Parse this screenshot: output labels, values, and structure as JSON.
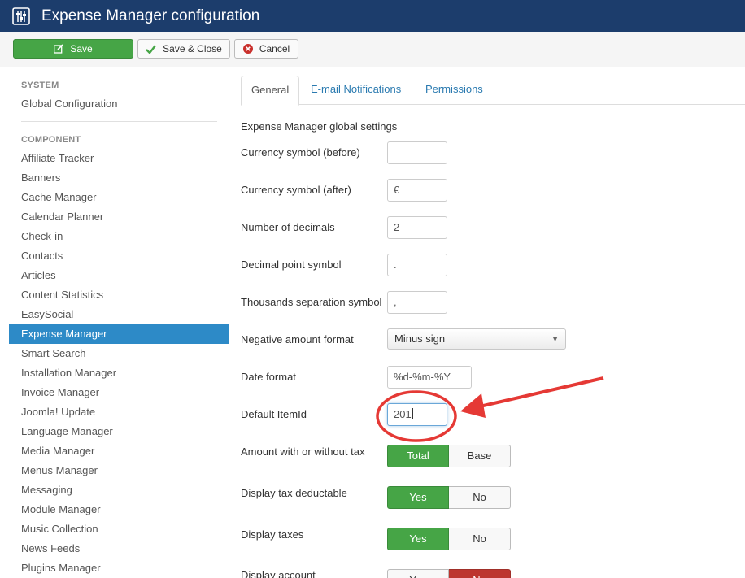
{
  "window": {
    "title": "Expense Manager configuration",
    "app_icon": "sliders-icon"
  },
  "toolbar": {
    "save": {
      "label": "Save",
      "icon": "edit-icon"
    },
    "save_close": {
      "label": "Save & Close",
      "icon": "check-icon"
    },
    "cancel": {
      "label": "Cancel",
      "icon": "cancel-circle-icon"
    }
  },
  "sidebar": {
    "system_heading": "SYSTEM",
    "global_config": "Global Configuration",
    "component_heading": "COMPONENT",
    "items": [
      {
        "label": "Affiliate Tracker"
      },
      {
        "label": "Banners"
      },
      {
        "label": "Cache Manager"
      },
      {
        "label": "Calendar Planner"
      },
      {
        "label": "Check-in"
      },
      {
        "label": "Contacts"
      },
      {
        "label": "Articles"
      },
      {
        "label": "Content Statistics"
      },
      {
        "label": "EasySocial"
      },
      {
        "label": "Expense Manager",
        "active": true
      },
      {
        "label": "Smart Search"
      },
      {
        "label": "Installation Manager"
      },
      {
        "label": "Invoice Manager"
      },
      {
        "label": "Joomla! Update"
      },
      {
        "label": "Language Manager"
      },
      {
        "label": "Media Manager"
      },
      {
        "label": "Menus Manager"
      },
      {
        "label": "Messaging"
      },
      {
        "label": "Module Manager"
      },
      {
        "label": "Music Collection"
      },
      {
        "label": "News Feeds"
      },
      {
        "label": "Plugins Manager"
      }
    ]
  },
  "tabs": [
    {
      "label": "General",
      "active": true
    },
    {
      "label": "E-mail Notifications"
    },
    {
      "label": "Permissions"
    }
  ],
  "form": {
    "section_title": "Expense Manager global settings",
    "currency_before": {
      "label": "Currency symbol (before)",
      "value": ""
    },
    "currency_after": {
      "label": "Currency symbol (after)",
      "value": "€"
    },
    "decimals": {
      "label": "Number of decimals",
      "value": "2"
    },
    "decimal_point": {
      "label": "Decimal point symbol",
      "value": "."
    },
    "thousands_sep": {
      "label": "Thousands separation symbol",
      "value": ","
    },
    "negative_format": {
      "label": "Negative amount format",
      "value": "Minus sign"
    },
    "date_format": {
      "label": "Date format",
      "value": "%d-%m-%Y"
    },
    "default_itemid": {
      "label": "Default ItemId",
      "value": "201"
    },
    "amount_tax": {
      "label": "Amount with or without tax",
      "option_a": "Total",
      "option_b": "Base",
      "selected": "Total"
    },
    "tax_deductable": {
      "label": "Display tax deductable",
      "option_a": "Yes",
      "option_b": "No",
      "selected": "Yes"
    },
    "display_taxes": {
      "label": "Display taxes",
      "option_a": "Yes",
      "option_b": "No",
      "selected": "Yes"
    },
    "display_account": {
      "label": "Display account",
      "option_a": "Yes",
      "option_b": "No",
      "selected": "No"
    }
  },
  "colors": {
    "header_bg": "#1c3d6c",
    "success": "#46a546",
    "danger": "#bd362f",
    "active_item": "#2d8ac7",
    "annotation": "#e53935"
  }
}
